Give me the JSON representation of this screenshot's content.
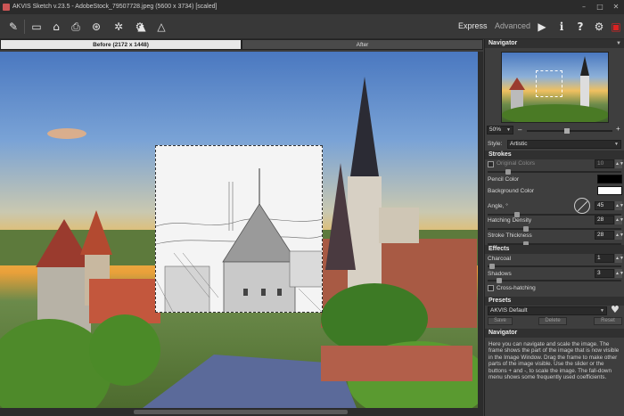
{
  "window": {
    "title": "AKVIS Sketch v.23.5 - AdobeStock_79507728.jpeg (5600 x 3734) [scaled]",
    "controls": [
      "–",
      "□",
      "✕"
    ]
  },
  "toolbar": {
    "tools": [
      {
        "name": "open-brush-icon",
        "glyph": "✎"
      },
      {
        "name": "open-file-icon",
        "glyph": "▭"
      },
      {
        "name": "save-icon",
        "glyph": "⌂"
      },
      {
        "name": "print-icon",
        "glyph": "⎙"
      },
      {
        "name": "share-icon",
        "glyph": "⊛"
      },
      {
        "name": "batch-icon",
        "glyph": "✲"
      },
      {
        "name": "presets-icon",
        "glyph": "⚙"
      },
      {
        "name": "tone-icon",
        "glyph": "▲"
      },
      {
        "name": "scene-icon",
        "glyph": "△"
      }
    ],
    "mode_express": "Express",
    "mode_advanced": "Advanced",
    "run_glyph": "▶",
    "info_glyph": "i",
    "help_glyph": "?",
    "settings_glyph": "⚙",
    "support_glyph": "▣"
  },
  "tabs": {
    "before": "Before (2172 x 1448)",
    "after": "After"
  },
  "navigator": {
    "title": "Navigator",
    "zoom": "50%",
    "minus": "–",
    "plus": "+"
  },
  "settings": {
    "style_label": "Style:",
    "style_value": "Artistic",
    "strokes_title": "Strokes",
    "original_colors": "Original Colors",
    "original_colors_value": "10",
    "pencil_color": "Pencil Color",
    "background_color": "Background Color",
    "angle_label": "Angle, °",
    "angle_value": "45",
    "hatching_density": "Hatching Density",
    "hatching_density_value": "28",
    "stroke_thickness": "Stroke Thickness",
    "stroke_thickness_value": "28",
    "effects_title": "Effects",
    "charcoal": "Charcoal",
    "charcoal_value": "1",
    "shadows": "Shadows",
    "shadows_value": "3",
    "cross_hatching": "Cross-hatching",
    "colors": {
      "pencil": "#000000",
      "background": "#ffffff"
    }
  },
  "presets": {
    "title": "Presets",
    "value": "AKVIS Default",
    "save": "Save",
    "delete": "Delete",
    "reset": "Reset"
  },
  "help": {
    "title": "Navigator",
    "text": "Here you can navigate and scale the image. The frame shows the part of the image that is now visible in the Image Window. Drag the frame to make other parts of the image visible. Use the slider or the buttons + and -, to scale the image. The fall-down menu shows some frequently used coefficients."
  }
}
